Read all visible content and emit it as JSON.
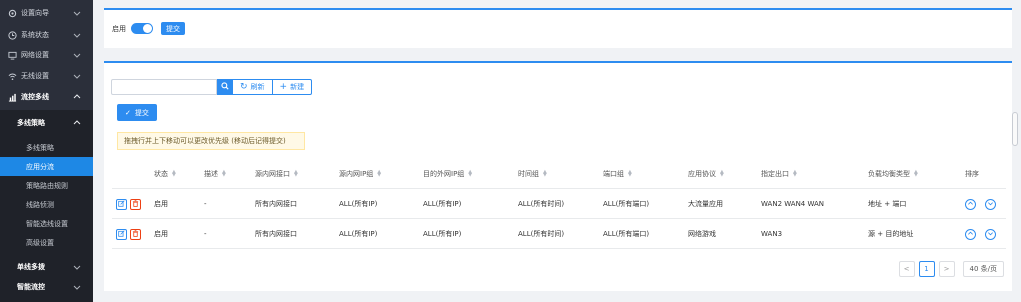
{
  "sidebar": {
    "items": [
      {
        "label": "设置向导",
        "icon": "gear-icon"
      },
      {
        "label": "系统状态",
        "icon": "clock-icon"
      },
      {
        "label": "网络设置",
        "icon": "monitor-icon"
      },
      {
        "label": "无线设置",
        "icon": "wifi-icon"
      },
      {
        "label": "流控多线",
        "icon": "chart-icon"
      }
    ],
    "submenu_header": "多线策略",
    "submenu_items": [
      "多线策略",
      "应用分流",
      "策略路由规则",
      "线路侦测",
      "智能选线设置",
      "高级设置"
    ],
    "active_item": "应用分流",
    "bottom_items": [
      "单线多拨",
      "智能流控"
    ]
  },
  "top_card": {
    "enable_label": "启用",
    "enabled": true,
    "submit_label": "提交"
  },
  "toolbar": {
    "search_placeholder": "",
    "refresh_label": "刷新",
    "new_label": "新建",
    "submit_label": "提交"
  },
  "tip": "拖拽行并上下移动可以更改优先级 (移动后记得提交)",
  "table": {
    "columns": [
      "状态",
      "描述",
      "源内网接口",
      "源内网IP组",
      "目的外网IP组",
      "时间组",
      "端口组",
      "应用协议",
      "指定出口",
      "负载均衡类型",
      "排序"
    ],
    "rows": [
      [
        "启用",
        "-",
        "所有内网接口",
        "ALL(所有IP)",
        "ALL(所有IP)",
        "ALL(所有时间)",
        "ALL(所有端口)",
        "大流量应用",
        "WAN2 WAN4 WAN",
        "地址 + 端口"
      ],
      [
        "启用",
        "-",
        "所有内网接口",
        "ALL(所有IP)",
        "ALL(所有IP)",
        "ALL(所有时间)",
        "ALL(所有端口)",
        "网络游戏",
        "WAN3",
        "源 + 目的地址"
      ]
    ]
  },
  "pager": {
    "prev": "<",
    "page": "1",
    "next": ">",
    "page_size": "40 条/页"
  },
  "colors": {
    "sidebar_bg": "#2b2f3a",
    "accent": "#2d8cf0",
    "danger": "#ed4014"
  }
}
